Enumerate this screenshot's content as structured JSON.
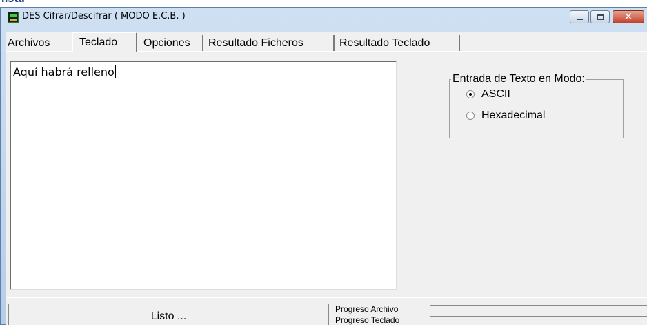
{
  "top_cut_text": "nSta",
  "window": {
    "title": "DES Cifrar/Descifrar ( MODO E.C.B. )",
    "app_icon": "des-app-icon",
    "controls": {
      "minimize_icon": "minimize-icon",
      "maximize_icon": "maximize-icon",
      "close_glyph": "✕"
    }
  },
  "tabs": [
    {
      "label": "Archivos",
      "active": false
    },
    {
      "label": "Teclado",
      "active": true
    },
    {
      "label": "Opciones",
      "active": false
    },
    {
      "label": "Resultado Ficheros",
      "active": false
    },
    {
      "label": "Resultado Teclado",
      "active": false
    }
  ],
  "editor": {
    "value": "Aquí habrá relleno"
  },
  "input_mode": {
    "legend": "Entrada de Texto en Modo:",
    "options": [
      {
        "label": "ASCII",
        "selected": true
      },
      {
        "label": "Hexadecimal",
        "selected": false
      }
    ]
  },
  "status": {
    "text": "Listo ...",
    "progress_file_label": "Progreso Archivo",
    "progress_keyboard_label": "Progreso Teclado",
    "progress_file_value": 0,
    "progress_keyboard_value": 0,
    "progress_color": "#06b025"
  }
}
